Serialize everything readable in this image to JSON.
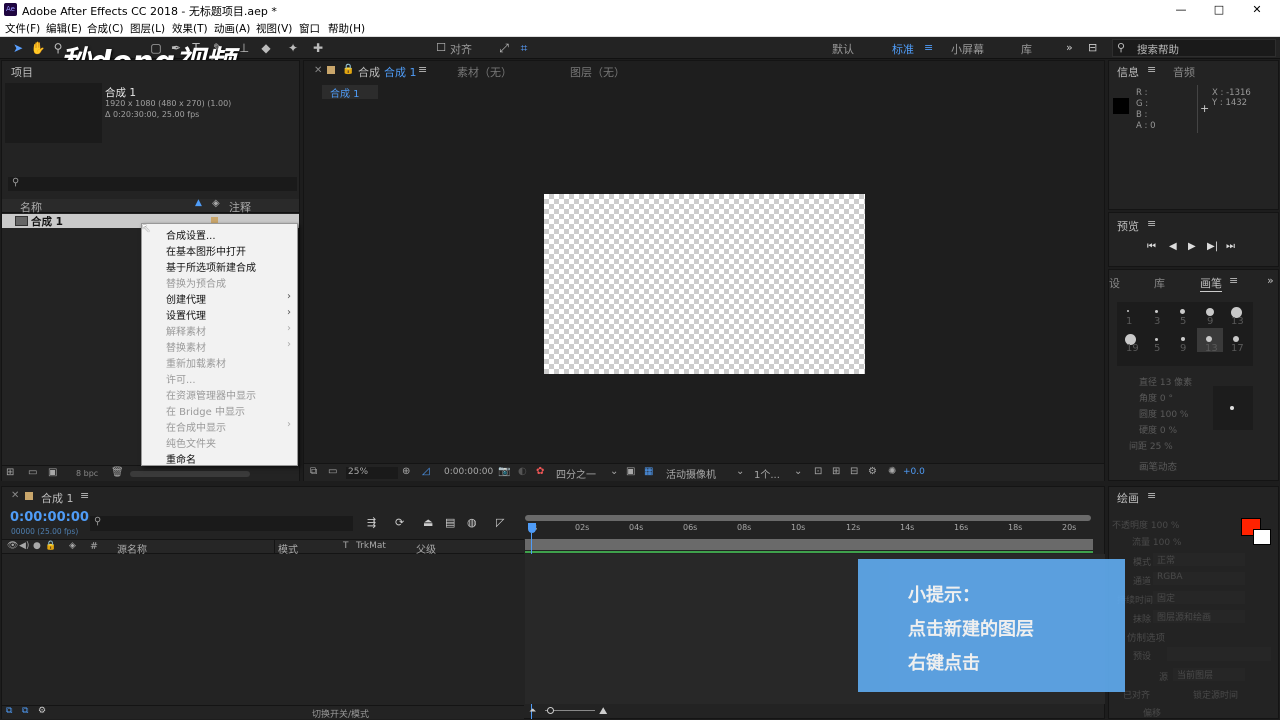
{
  "window": {
    "title": "Adobe After Effects CC 2018 - 无标题项目.aep *",
    "app_icon": "Ae",
    "controls": [
      "—",
      "□",
      "✕"
    ]
  },
  "menu": [
    "文件(F)",
    "编辑(E)",
    "合成(C)",
    "图层(L)",
    "效果(T)",
    "动画(A)",
    "视图(V)",
    "窗口",
    "帮助(H)"
  ],
  "toolbar": {
    "snap_label": "对齐",
    "workspaces": [
      "默认",
      "标准",
      "小屏幕",
      "库"
    ],
    "active_workspace": "标准",
    "search_placeholder": "搜索帮助",
    "watermark": "秒dong视频"
  },
  "project": {
    "tab": "项目",
    "comp_name": "合成 1",
    "comp_size": "1920 x 1080  (480 x 270) (1.00)",
    "comp_duration": "Δ 0:20:30:00, 25.00 fps",
    "col_name": "名称",
    "col_comment": "注释",
    "item": "合成 1",
    "bpc": "8 bpc"
  },
  "context_menu": [
    {
      "label": "合成设置...",
      "enabled": true,
      "sub": false
    },
    {
      "label": "在基本图形中打开",
      "enabled": true,
      "sub": false
    },
    {
      "label": "基于所选项新建合成",
      "enabled": true,
      "sub": false
    },
    {
      "label": "替换为预合成",
      "enabled": false,
      "sub": false
    },
    {
      "label": "创建代理",
      "enabled": true,
      "sub": true
    },
    {
      "label": "设置代理",
      "enabled": true,
      "sub": true
    },
    {
      "label": "解释素材",
      "enabled": false,
      "sub": true
    },
    {
      "label": "替换素材",
      "enabled": false,
      "sub": true
    },
    {
      "label": "重新加载素材",
      "enabled": false,
      "sub": false
    },
    {
      "label": "许可...",
      "enabled": false,
      "sub": false
    },
    {
      "label": "在资源管理器中显示",
      "enabled": false,
      "sub": false
    },
    {
      "label": "在 Bridge 中显示",
      "enabled": false,
      "sub": false
    },
    {
      "label": "在合成中显示",
      "enabled": false,
      "sub": true
    },
    {
      "label": "纯色文件夹",
      "enabled": false,
      "sub": false
    },
    {
      "label": "重命名",
      "enabled": true,
      "sub": false
    }
  ],
  "viewer": {
    "comp_tab": "合成",
    "comp_tab_name": "合成 1",
    "footage_tab": "素材（无）",
    "layer_tab": "图层（无）",
    "sub_tab": "合成 1",
    "zoom": "25%",
    "timecode": "0:00:00:00",
    "resolution": "四分之一",
    "camera": "活动摄像机",
    "views": "1个...",
    "exposure": "+0.0"
  },
  "info": {
    "tab": "信息",
    "audio_tab": "音频",
    "r": "R :",
    "g": "G :",
    "b": "B :",
    "a": "A : 0",
    "x": "X : -1316",
    "y": "Y : 1432"
  },
  "preview": {
    "tab": "预览",
    "controls": [
      "⏮",
      "◀",
      "▶",
      "▶|",
      "⏭"
    ]
  },
  "brushes": {
    "tabs": [
      "设",
      "库",
      "画笔"
    ],
    "sizes": [
      "1",
      "3",
      "5",
      "9",
      "13",
      "19",
      "5",
      "9",
      "13",
      "17"
    ],
    "diameter": "直径  13 像素",
    "angle": "角度  0 °",
    "roundness": "圆度  100 %",
    "hardness": "硬度  0 %",
    "spacing": "间距  25 %",
    "dynamics": "画笔动态"
  },
  "paint": {
    "tab": "绘画",
    "opacity": "不透明度  100 %",
    "flow": "流量  100 %",
    "mode_label": "模式",
    "mode": "正常",
    "channel_label": "通道",
    "channel": "RGBA",
    "duration_label": "持续时间",
    "duration": "固定",
    "erase_label": "抹除",
    "erase": "图层源和绘画",
    "clone_label": "仿制选项",
    "preset_label": "预设",
    "source_label": "源",
    "source": "当前图层",
    "aligned": "已对齐",
    "lock_source": "锁定源时间",
    "offset": "偏移",
    "fg_color": "#ff2200",
    "bg_color": "#ffffff"
  },
  "timeline": {
    "tab": "合成 1",
    "timecode": "0:00:00:00",
    "frames": "00000 (25.00 fps)",
    "cols": [
      "#",
      "源名称",
      "模式",
      "T",
      "TrkMat",
      "父级"
    ],
    "ticks": [
      "0s",
      "02s",
      "04s",
      "06s",
      "08s",
      "10s",
      "12s",
      "14s",
      "16s",
      "18s",
      "20s"
    ],
    "toggle": "切换开关/模式"
  },
  "tip": {
    "title": "小提示：",
    "line1": "点击新建的图层",
    "line2": "右键点击"
  }
}
